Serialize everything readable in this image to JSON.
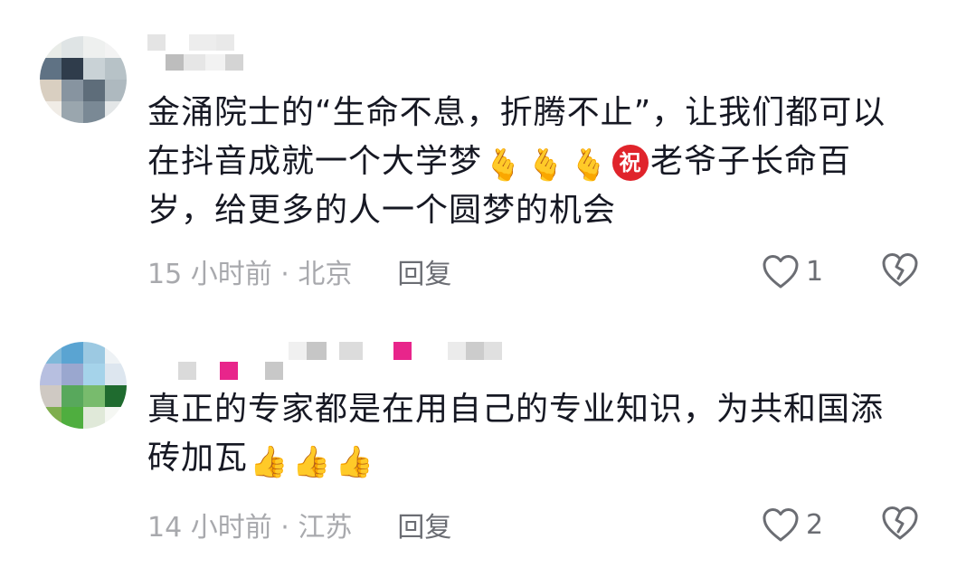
{
  "comments": [
    {
      "segments": [
        "金涌院士的“生命不息，折腾不止”，让我们都可以在抖音成就一个大学梦",
        "🫰",
        "🫰",
        "🫰",
        "祝",
        "老爷子长命百岁，给更多的人一个圆梦的机会"
      ],
      "time_location": "15 小时前 · 北京",
      "reply_label": "回复",
      "like_count": "1"
    },
    {
      "segments": [
        "真正的专家都是在用自己的专业知识，为共和国添砖加瓦",
        "👍",
        "👍",
        "👍"
      ],
      "time_location": "14 小时前 · 江苏",
      "reply_label": "回复",
      "like_count": "2"
    }
  ],
  "icons": {
    "like": "heart-outline-icon",
    "dislike": "broken-heart-icon"
  },
  "colors": {
    "text": "#161823",
    "meta": "#a8a9ad",
    "action": "#6b6d73",
    "badge": "#e0242b"
  }
}
